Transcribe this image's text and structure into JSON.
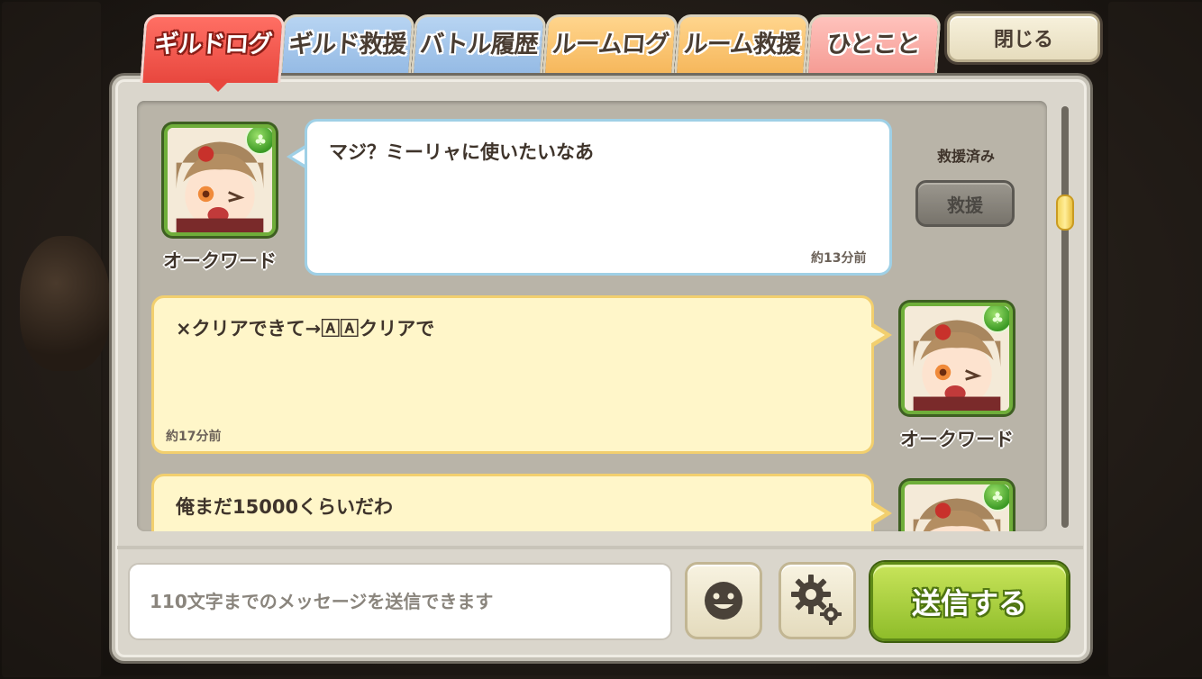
{
  "tabs": [
    {
      "label": "ギルドログ",
      "active": true
    },
    {
      "label": "ギルド救援",
      "active": false
    },
    {
      "label": "バトル履歴",
      "active": false
    },
    {
      "label": "ルームログ",
      "active": false
    },
    {
      "label": "ルーム救援",
      "active": false
    },
    {
      "label": "ひとこと",
      "active": false
    }
  ],
  "close_label": "閉じる",
  "messages": [
    {
      "sender": "オークワード",
      "text": "マジ？ミーリャに使いたいなあ",
      "time": "約13分前",
      "side": "left",
      "status": "救援済み",
      "action": "救援"
    },
    {
      "sender": "オークワード",
      "text": "×クリアできて→🄰🄰クリアで",
      "time": "約17分前",
      "side": "right"
    },
    {
      "sender": "",
      "text": "俺まだ15000くらいだわ",
      "time": "",
      "side": "right"
    }
  ],
  "input": {
    "placeholder": "110文字までのメッセージを送信できます",
    "value": ""
  },
  "buttons": {
    "stamp": "smiley-icon",
    "settings": "gear-icon",
    "send": "送信する"
  },
  "colors": {
    "active_tab": "#e8473e",
    "send_button": "#8fbd2a",
    "avatar_frame": "#6fae3a"
  }
}
